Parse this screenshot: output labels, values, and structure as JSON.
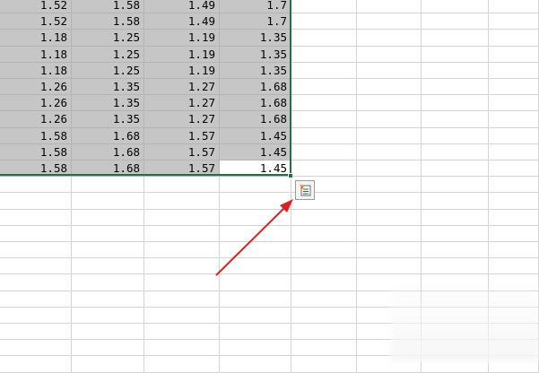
{
  "sheet": {
    "rows": [
      [
        "1.52",
        "1.58",
        "1.49",
        "1.7"
      ],
      [
        "1.52",
        "1.58",
        "1.49",
        "1.7"
      ],
      [
        "1.18",
        "1.25",
        "1.19",
        "1.35"
      ],
      [
        "1.18",
        "1.25",
        "1.19",
        "1.35"
      ],
      [
        "1.18",
        "1.25",
        "1.19",
        "1.35"
      ],
      [
        "1.26",
        "1.35",
        "1.27",
        "1.68"
      ],
      [
        "1.26",
        "1.35",
        "1.27",
        "1.68"
      ],
      [
        "1.26",
        "1.35",
        "1.27",
        "1.68"
      ],
      [
        "1.58",
        "1.68",
        "1.57",
        "1.45"
      ],
      [
        "1.58",
        "1.68",
        "1.57",
        "1.45"
      ],
      [
        "1.58",
        "1.68",
        "1.57",
        "1.45"
      ]
    ],
    "active_cell": {
      "row": 10,
      "col": 3
    }
  },
  "quick_analysis": {
    "icon": "quick-analysis-icon"
  },
  "annotation": {
    "arrow_color": "#e0201f"
  },
  "colors": {
    "selection_fill": "#c6c6c6",
    "selection_border": "#217346",
    "gridline": "#d4d4d4"
  }
}
